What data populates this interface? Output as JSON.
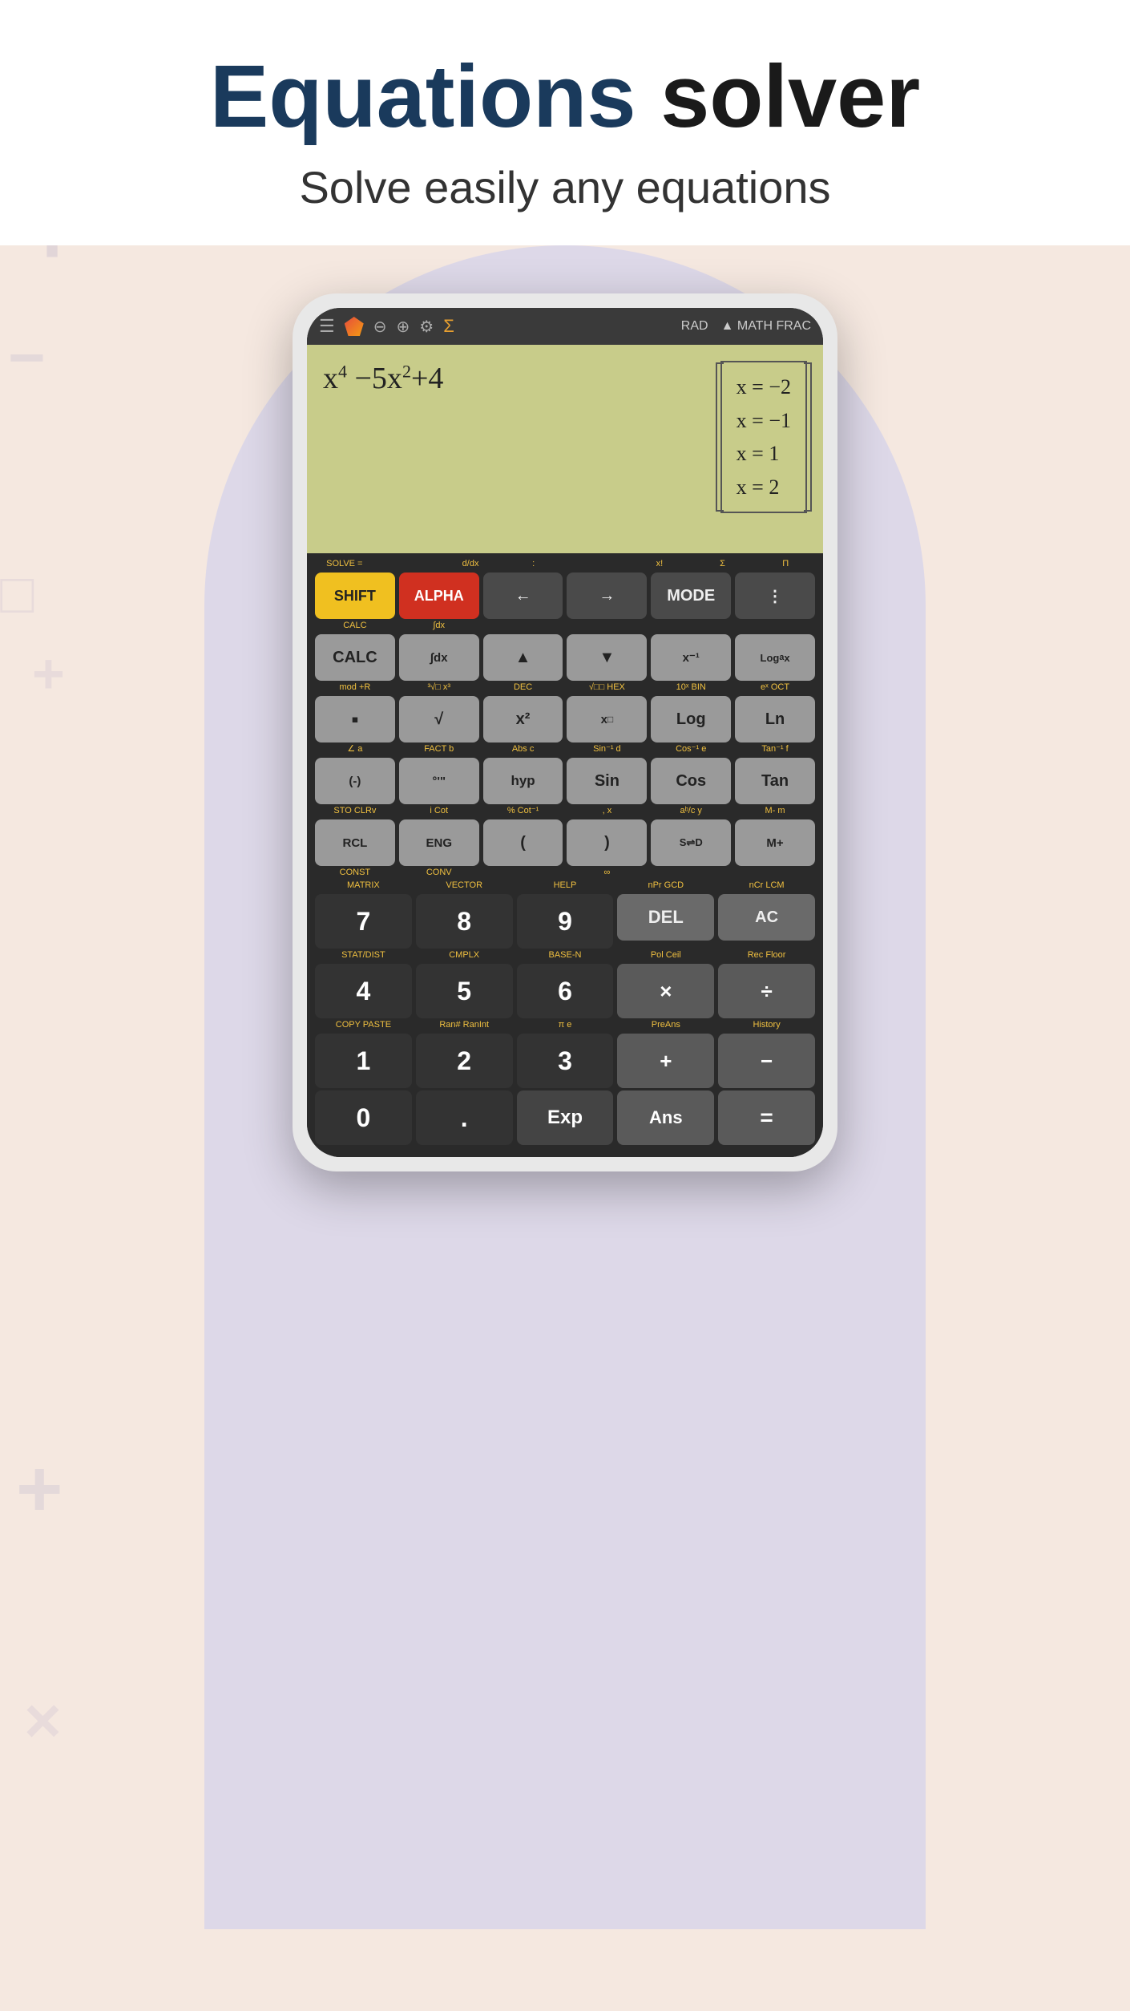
{
  "page": {
    "title": "Equations solver",
    "title_part1": "Equations",
    "title_part2": " solver",
    "subtitle": "Solve easily any equations"
  },
  "calculator": {
    "header": {
      "mode": "RAD",
      "math_indicator": "▲ MATH FRAC"
    },
    "display": {
      "equation": "x⁴ - 5x² + 4",
      "results": [
        "x = -2",
        "x = -1",
        "x = 1",
        "x = 2"
      ]
    },
    "rows": {
      "row1_sublabels": [
        "SOLVE =",
        "",
        "d/dx",
        ":",
        "",
        "",
        "x!",
        "",
        "Σ",
        "Π"
      ],
      "row1": [
        "SHIFT",
        "ALPHA",
        "←",
        "→",
        "MODE",
        "⋮"
      ],
      "row2_sublabels": [
        "CALC",
        "",
        "∫dx",
        "",
        "",
        "",
        "",
        "",
        "",
        ""
      ],
      "row2": [
        "CALC",
        "∫dx",
        "▲",
        "▼",
        "x⁻¹",
        "Logₐx"
      ],
      "row3_sublabels": [
        "mod",
        "+R",
        "³√□",
        "x³",
        "DEC",
        "√□□",
        "HEX",
        "10ˣ",
        "BIN",
        "eˣ",
        "OCT"
      ],
      "row3": [
        "■",
        "√",
        "x²",
        "x□",
        "Log",
        "Ln"
      ],
      "row4_sublabels": [
        "∠",
        "a",
        "FACT",
        "b",
        "Abs",
        "c",
        "Sin⁻¹",
        "d",
        "Cos⁻¹",
        "e",
        "Tan⁻¹",
        "f"
      ],
      "row4": [
        "(-)",
        "°'\"",
        "hyp",
        "Sin",
        "Cos",
        "Tan"
      ],
      "row5_sublabels": [
        "STO",
        "CLRv",
        "i",
        "Cot",
        "%",
        "Cot⁻¹",
        ",",
        "x",
        "aᵇ/c",
        "y",
        "M-",
        "m"
      ],
      "row5": [
        "RCL",
        "ENG",
        "(",
        ")",
        "S⇌D",
        "M+"
      ],
      "row6_sublabels": [
        "CONST",
        "",
        "CONV",
        "",
        "",
        "∞",
        "",
        "",
        "",
        ""
      ],
      "num_row1_sublabels": [
        "MATRIX",
        "",
        "VECTOR",
        "",
        "HELP",
        "",
        "nPr",
        "GCD",
        "nCr",
        "LCM"
      ],
      "num_row1": [
        "7",
        "8",
        "9",
        "DEL",
        "AC"
      ],
      "num_row2_sublabels": [
        "STAT/DIST",
        "",
        "CMPLX",
        "",
        "BASE-N",
        "",
        "Pol",
        "Ceil",
        "Rec",
        "Floor"
      ],
      "num_row2": [
        "4",
        "5",
        "6",
        "×",
        "÷"
      ],
      "num_row3_sublabels": [
        "COPY",
        "PASTE",
        "Ran#",
        "RanInt",
        "π",
        "",
        "e",
        "",
        "PreAns",
        "",
        "History"
      ],
      "num_row3": [
        "1",
        "2",
        "3",
        "+",
        "-"
      ],
      "num_row4": [
        "0",
        ".",
        "Exp",
        "Ans",
        "="
      ]
    }
  }
}
